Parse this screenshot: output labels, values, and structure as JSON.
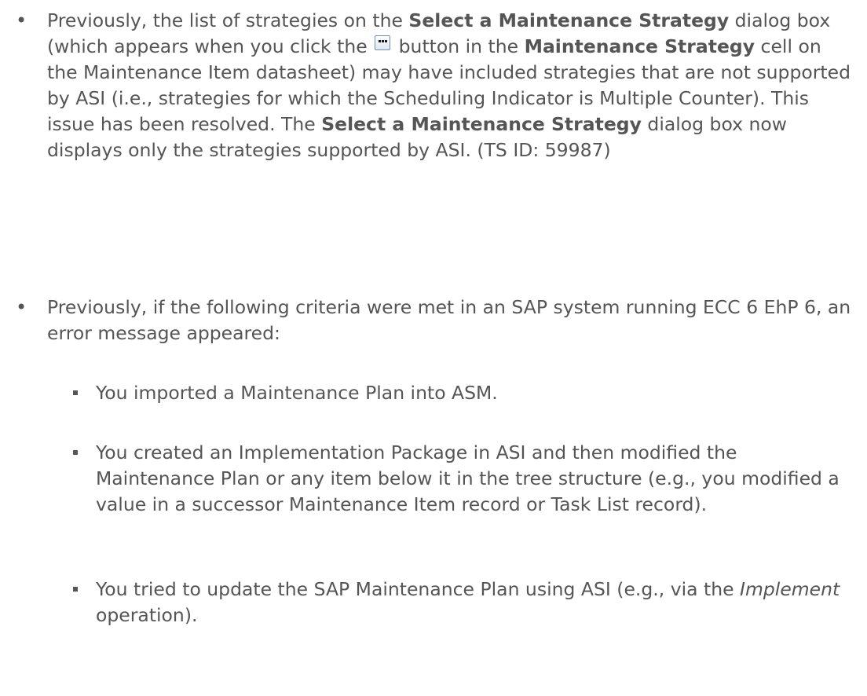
{
  "bullets": [
    {
      "seg1": "Previously, the list of strategies on the ",
      "bold1": "Select a Maintenance Strategy",
      "seg2": " dialog box (which appears when you click the ",
      "icon": "ellipsis-button-icon",
      "seg3": " button in the ",
      "bold2": "Maintenance Strategy",
      "seg4": " cell on the Maintenance Item datasheet) may have included strategies that are not supported by ASI (i.e., strategies for which the Scheduling Indicator is Multiple Counter). This issue has been resolved. The ",
      "bold3": "Select a Maintenance Strategy",
      "seg5": " dialog box now displays only the strategies supported by ASI. (TS ID: 59987)"
    },
    {
      "text": "Previously, if the following criteria were met in an SAP system running ECC 6 EhP 6, an error message appeared:"
    }
  ],
  "subitems": [
    {
      "text": "You imported a Maintenance Plan into ASM."
    },
    {
      "text": "You created an Implementation Package in ASI and then modified the Maintenance Plan or any item below it in the tree structure (e.g., you modified a value in a successor Maintenance Item record or Task List record)."
    },
    {
      "seg1": "You tried to update the SAP Maintenance Plan using ASI (e.g., via the ",
      "italic": "Implement",
      "seg2": " operation)."
    }
  ]
}
